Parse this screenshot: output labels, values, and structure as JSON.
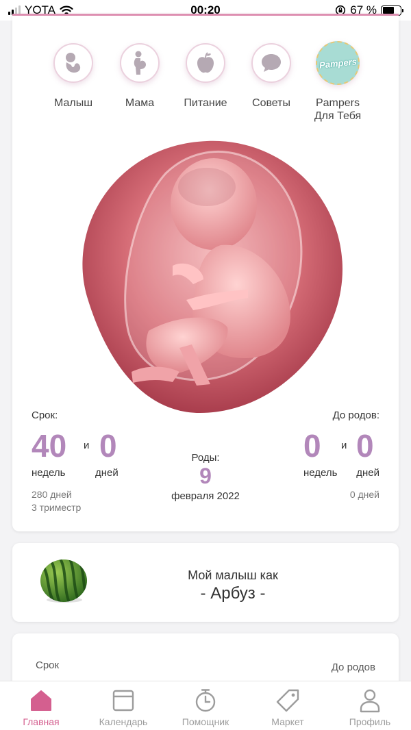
{
  "status_bar": {
    "carrier": "YOTA",
    "time": "00:20",
    "battery_label": "67 %",
    "battery_level": 0.67
  },
  "colors": {
    "accent": "#b287ba",
    "active_tab": "#d45f8f",
    "pink_line": "#dd8fb1",
    "muted": "#9c9c9c"
  },
  "categories": [
    {
      "label": "Малыш",
      "icon": "baby-icon"
    },
    {
      "label": "Мама",
      "icon": "pregnant-woman-icon"
    },
    {
      "label": "Питание",
      "icon": "apple-icon"
    },
    {
      "label": "Советы",
      "icon": "speech-bubble-icon"
    },
    {
      "label": "Pampers\nДля Тебя",
      "icon": "pampers-logo",
      "brand_text": "Pampers"
    }
  ],
  "pregnancy": {
    "term_label": "Срок:",
    "weeks": "40",
    "and": "и",
    "days": "0",
    "weeks_unit": "недель",
    "days_unit": "дней",
    "total_days": "280 дней",
    "trimester": "3 триместр",
    "due_label": "Роды:",
    "due_day": "9",
    "due_month_year": "февраля 2022",
    "until_label": "До родов:",
    "until_weeks": "0",
    "until_days": "0",
    "until_total": "0 дней"
  },
  "fruit": {
    "intro": "Мой малыш как",
    "name": "- Арбуз -",
    "icon": "watermelon-icon"
  },
  "third_card": {
    "left_label": "Срок",
    "right_label": "До родов"
  },
  "tabs": [
    {
      "label": "Главная",
      "icon": "home-icon",
      "active": true
    },
    {
      "label": "Календарь",
      "icon": "calendar-icon",
      "active": false
    },
    {
      "label": "Помощник",
      "icon": "stopwatch-icon",
      "active": false
    },
    {
      "label": "Маркет",
      "icon": "tag-icon",
      "active": false
    },
    {
      "label": "Профиль",
      "icon": "profile-icon",
      "active": false
    }
  ]
}
